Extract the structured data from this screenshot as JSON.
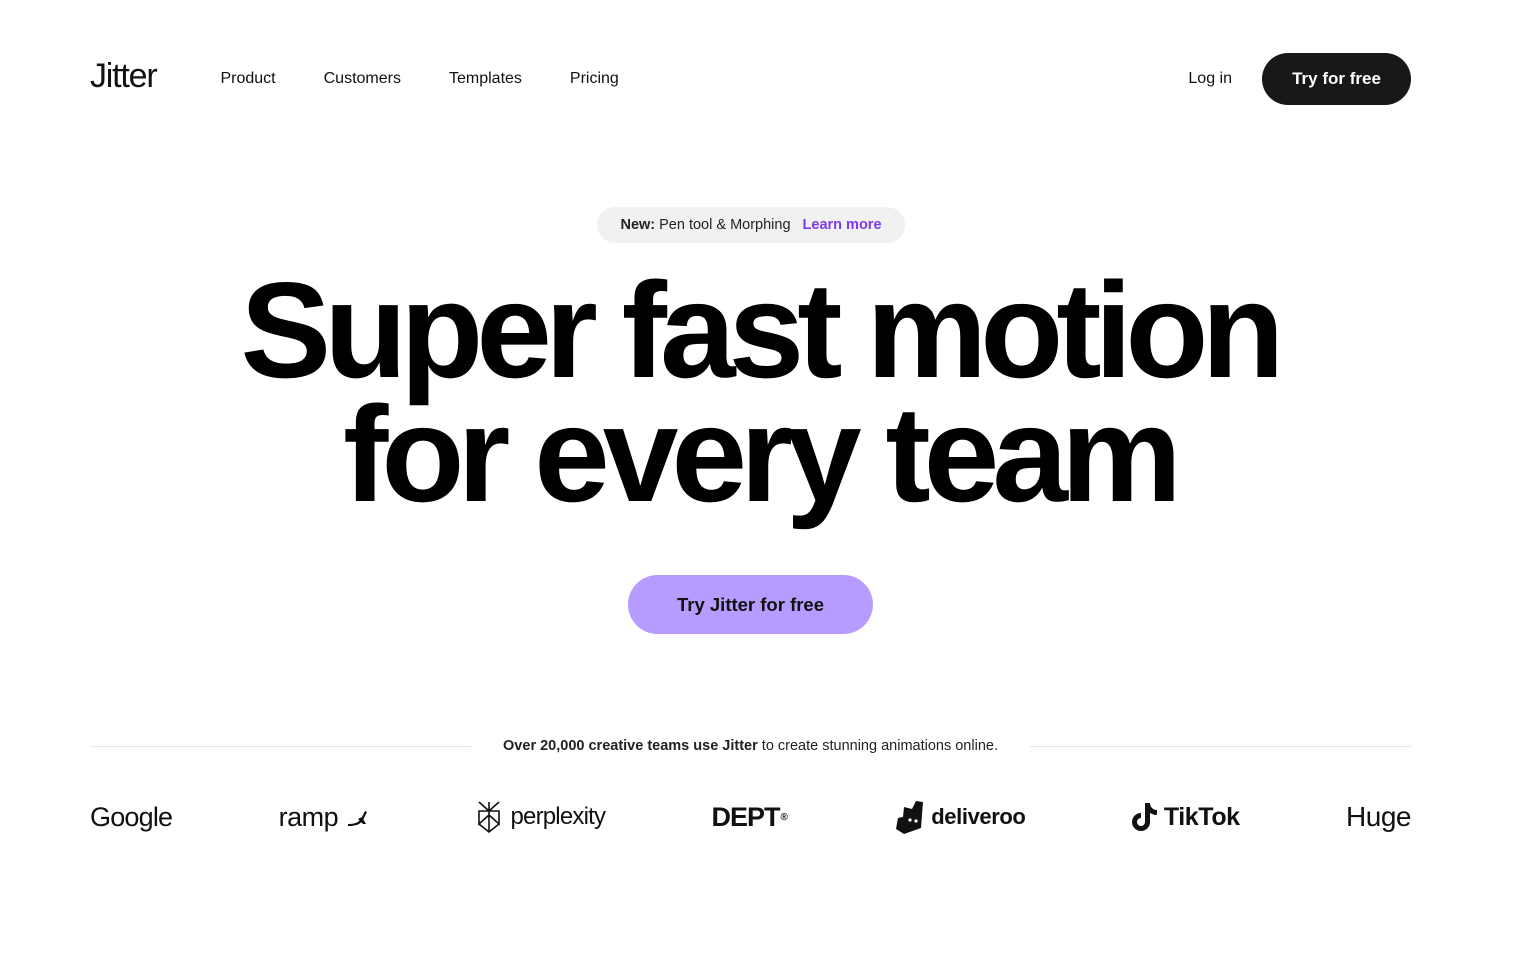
{
  "header": {
    "logo": "Jitter",
    "nav": [
      {
        "label": "Product"
      },
      {
        "label": "Customers"
      },
      {
        "label": "Templates"
      },
      {
        "label": "Pricing"
      }
    ],
    "login_label": "Log in",
    "cta_label": "Try for free"
  },
  "announcement": {
    "prefix": "New:",
    "text": "Pen tool & Morphing",
    "link": "Learn more"
  },
  "hero": {
    "line1": "Super fast motion",
    "line2": "for every team",
    "cta_label": "Try Jitter for free"
  },
  "proof": {
    "bold": "Over 20,000 creative teams use Jitter",
    "rest": " to create stunning animations online."
  },
  "brands": {
    "google": "Google",
    "ramp": "ramp",
    "perplexity": "perplexity",
    "dept": "DEPT",
    "dept_mark": "®",
    "deliveroo": "deliveroo",
    "tiktok": "TikTok",
    "huge": "Huge"
  },
  "colors": {
    "accent": "#b69cff",
    "link": "#7c3aed",
    "dark_button": "#18181b",
    "pill_bg": "#f1f1f2"
  }
}
